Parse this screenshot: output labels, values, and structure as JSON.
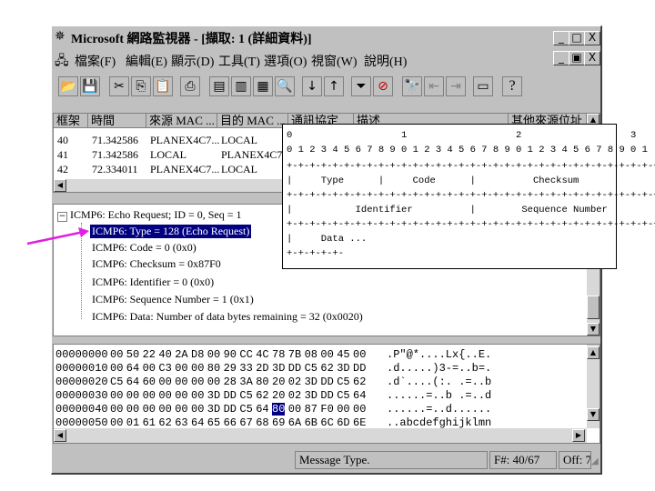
{
  "window": {
    "title": "Microsoft 網路監視器 - [擷取: 1 (詳細資料)]",
    "min": "_",
    "max": "□",
    "close": "X",
    "child_min": "_",
    "child_restore": "▣",
    "child_close": "X"
  },
  "menu": [
    "檔案(F)",
    "編輯(E)",
    "顯示(D)",
    "工具(T)",
    "選項(O)",
    "視窗(W)",
    "說明(H)"
  ],
  "toolbar": {
    "help_label": "?"
  },
  "frames": {
    "headers": [
      "框架",
      "時間",
      "來源 MAC ...",
      "目的 MAC ...",
      "通訊協定",
      "描述",
      "其他來源位址"
    ],
    "rows": [
      [
        "40",
        "71.342586",
        "PLANEX4C7...",
        "LOCAL"
      ],
      [
        "41",
        "71.342586",
        "LOCAL",
        "PLANEX4C7..."
      ],
      [
        "42",
        "72.334011",
        "PLANEX4C7...",
        "LOCAL"
      ]
    ]
  },
  "detail": {
    "root": "ICMP6: Echo Request; ID = 0, Seq = 1",
    "children": [
      "ICMP6: Type = 128 (Echo Request)",
      "ICMP6: Code = 0 (0x0)",
      "ICMP6: Checksum = 0x87F0",
      "ICMP6: Identifier = 0 (0x0)",
      "ICMP6: Sequence Number = 1 (0x1)",
      "ICMP6: Data: Number of data bytes remaining = 32 (0x0020)"
    ]
  },
  "hex": [
    {
      "off": "00000000",
      "bytes": "00 50 22 40 2A D8 00 90 CC 4C 78 7B 08 00 45 00",
      "ascii": ".P\"@*....Lx{..E."
    },
    {
      "off": "00000010",
      "bytes": "00 64 00 C3 00 00 80 29 33 2D 3D DD C5 62 3D DD",
      "ascii": ".d.....)3-=..b=."
    },
    {
      "off": "00000020",
      "bytes": "C5 64 60 00 00 00 00 28 3A 80 20 02 3D DD C5 62",
      "ascii": ".d`....(:. .=..b"
    },
    {
      "off": "00000030",
      "bytes": "00 00 00 00 00 00 3D DD C5 62 20 02 3D DD C5 64",
      "ascii": "......=..b .=..d"
    },
    {
      "off": "00000040",
      "bytes": "00 00 00 00 00 00 3D DD C5 64 80 00 87 F0 00 00",
      "ascii": "......=..d......"
    },
    {
      "off": "00000050",
      "bytes": "00 01 61 62 63 64 65 66 67 68 69 6A 6B 6C 6D 6E",
      "ascii": "..abcdefghijklmn"
    }
  ],
  "hex_selected": "80",
  "overlay": {
    "ruler1": "0                   1                   2                   3",
    "ruler2": "0 1 2 3 4 5 6 7 8 9 0 1 2 3 4 5 6 7 8 9 0 1 2 3 4 5 6 7 8 9 0 1",
    "sep": "+-+-+-+-+-+-+-+-+-+-+-+-+-+-+-+-+-+-+-+-+-+-+-+-+-+-+-+-+-+-+-+-+",
    "row1": "|     Type      |     Code      |          Checksum             |",
    "row2": "|           Identifier          |        Sequence Number        |",
    "row3": "|     Data ...",
    "sep_short": "+-+-+-+-+-"
  },
  "status": {
    "message": "Message Type.",
    "frame": "F#: 40/67",
    "offset": "Off: 7"
  },
  "colors": {
    "selection": "#000080",
    "arrow": "#e020e0",
    "chrome": "#c0c0c0"
  }
}
